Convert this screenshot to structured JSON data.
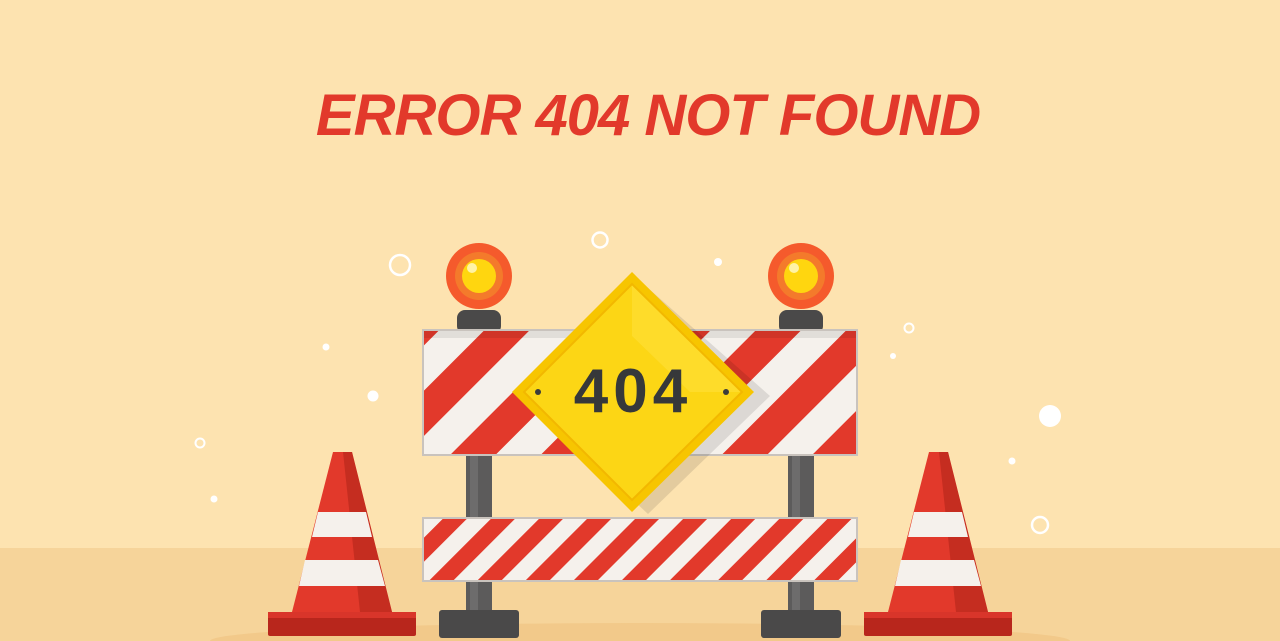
{
  "page": {
    "headline": "ERROR 404 NOT FOUND",
    "sign_text": "404"
  },
  "colors": {
    "background": "#fde3b0",
    "ground": "#f6d49a",
    "headline_red": "#e2392b",
    "stripe_red": "#e2392b",
    "stripe_light": "#f5f1ec",
    "sign_yellow": "#fcd615",
    "light_orange": "#f55a2c",
    "light_yellow": "#ffd60f",
    "post_gray": "#5c5b5b",
    "bubble_white": "#ffffff"
  },
  "icons": [
    "road-barrier-icon",
    "warning-sign-icon",
    "traffic-cone-icon",
    "warning-light-icon"
  ]
}
